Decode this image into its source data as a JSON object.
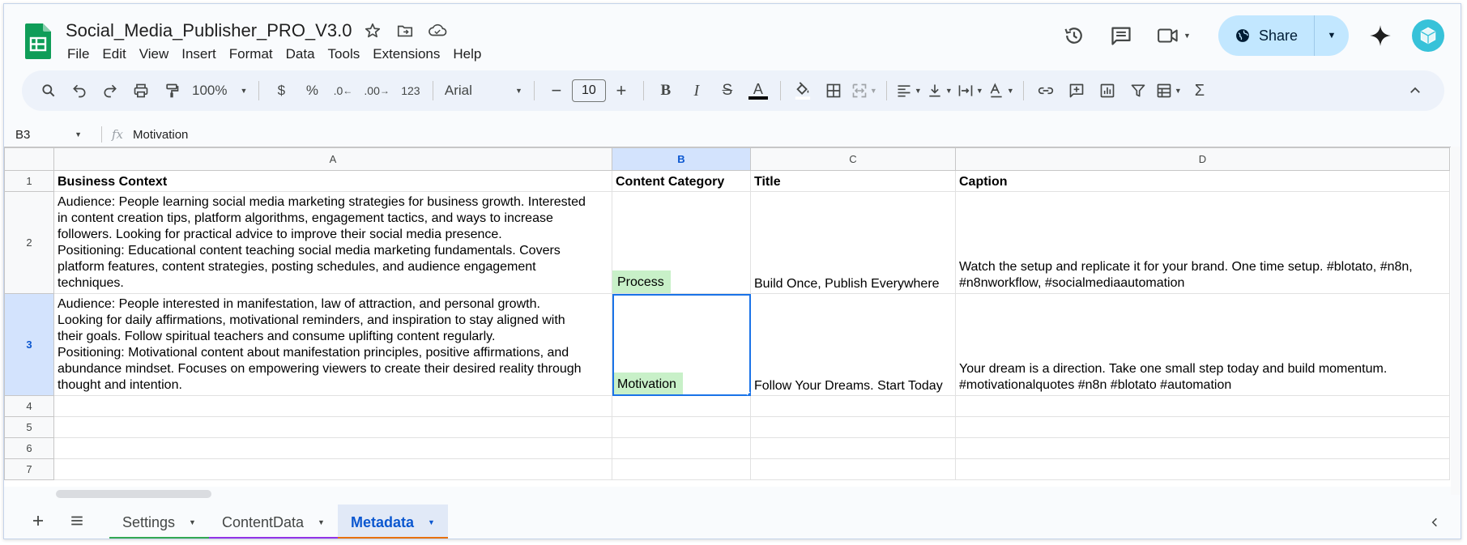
{
  "doc": {
    "title": "Social_Media_Publisher_PRO_V3.0"
  },
  "menu": [
    "File",
    "Edit",
    "View",
    "Insert",
    "Format",
    "Data",
    "Tools",
    "Extensions",
    "Help"
  ],
  "share": {
    "label": "Share"
  },
  "toolbar": {
    "zoom": "100%",
    "currency": "$",
    "percent": "%",
    "dec_less": ".0",
    "dec_more": ".00",
    "number_format": "123",
    "font": "Arial",
    "font_size": "10",
    "minus": "−",
    "plus": "+",
    "bold": "B",
    "italic": "I",
    "strike": "S",
    "text_color": "A",
    "sum": "Σ"
  },
  "formula_bar": {
    "name_box": "B3",
    "fx": "fx",
    "content": "Motivation"
  },
  "columns": [
    "A",
    "B",
    "C",
    "D"
  ],
  "rows": [
    {
      "num": "1",
      "A": "Business Context",
      "B": "Content Category",
      "C": "Title",
      "D": "Caption"
    },
    {
      "num": "2",
      "A_lines": [
        "Audience: People learning social media marketing strategies for business growth. Interested",
        "in content creation tips, platform algorithms, engagement tactics, and ways to increase",
        "followers. Looking for practical advice to improve their social media presence.",
        "Positioning: Educational content teaching social media marketing fundamentals. Covers",
        "platform features, content strategies, posting schedules, and audience engagement",
        "techniques."
      ],
      "B": "Process",
      "C": "Build Once, Publish Everywhere",
      "D_lines": [
        "Watch the setup and replicate it for your brand. One time setup. #blotato, #n8n,",
        "#n8nworkflow, #socialmediaautomation"
      ]
    },
    {
      "num": "3",
      "A_lines": [
        "Audience: People interested in manifestation, law of attraction, and personal growth.",
        "Looking for daily affirmations, motivational reminders, and inspiration to stay aligned with",
        "their goals. Follow spiritual teachers and consume uplifting content regularly.",
        "Positioning: Motivational content about manifestation principles, positive affirmations, and",
        "abundance mindset. Focuses on empowering viewers to create their desired reality through",
        "thought and intention."
      ],
      "B": "Motivation",
      "C": "Follow Your Dreams. Start Today",
      "D_lines": [
        "Your dream is a direction. Take one small step today and build momentum.",
        "#motivationalquotes #n8n #blotato #automation"
      ]
    },
    {
      "num": "4"
    },
    {
      "num": "5"
    },
    {
      "num": "6"
    },
    {
      "num": "7"
    }
  ],
  "sheets": [
    {
      "label": "Settings",
      "color": "#34a853"
    },
    {
      "label": "ContentData",
      "color": "#9334e6"
    },
    {
      "label": "Metadata",
      "color": "#e8710a",
      "active": true
    }
  ],
  "colors": {
    "accent": "#0b57d0",
    "share_bg": "#c2e7ff",
    "toolbar_bg": "#edf2fa",
    "green_cell": "#c8f0c8",
    "sheets_green": "#0f9d58"
  }
}
